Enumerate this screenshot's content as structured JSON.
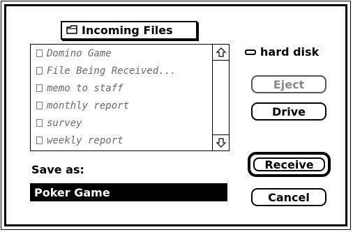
{
  "folder_popup": {
    "label": "Incoming Files",
    "icon": "folder-icon"
  },
  "files": [
    "Domino Game",
    "File Being Received...",
    "memo to staff",
    "monthly report",
    "survey",
    "weekly report"
  ],
  "volume": {
    "name": "hard disk",
    "icon": "disk-icon"
  },
  "buttons": {
    "eject": "Eject",
    "drive": "Drive",
    "receive": "Receive",
    "cancel": "Cancel"
  },
  "save_as": {
    "label": "Save as:",
    "value": "Poker Game"
  },
  "scroll": {
    "up_icon": "scroll-up-arrow-icon",
    "down_icon": "scroll-down-arrow-icon"
  }
}
